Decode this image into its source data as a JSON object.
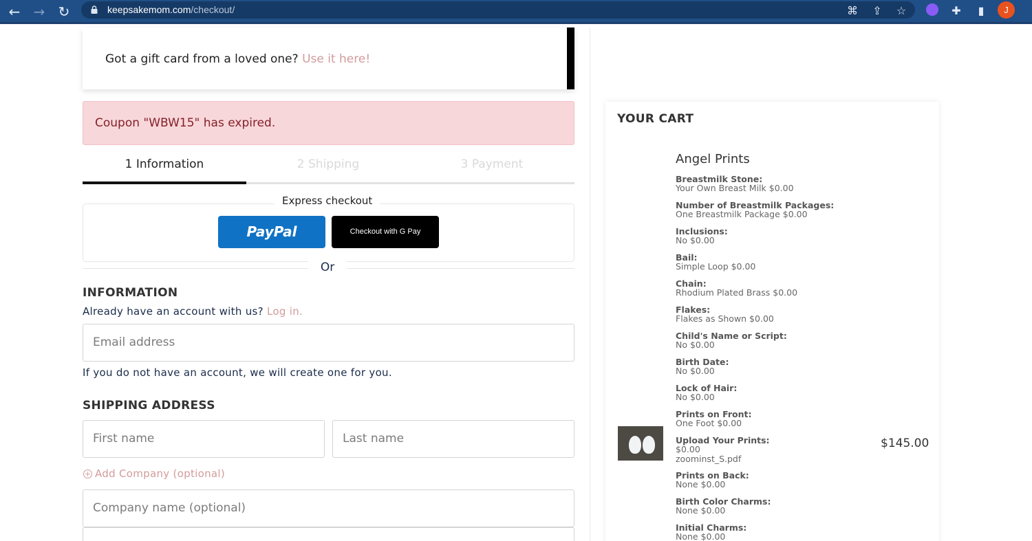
{
  "browser": {
    "url_host": "keepsakemom.com",
    "url_path": "/checkout/",
    "avatar_letter": "J"
  },
  "giftcard": {
    "prompt": "Got a gift card from a loved one?",
    "link": "Use it here!"
  },
  "alert": {
    "message": "Coupon \"WBW15\" has expired."
  },
  "steps": [
    {
      "label": "1 Information"
    },
    {
      "label": "2 Shipping"
    },
    {
      "label": "3 Payment"
    }
  ],
  "express": {
    "label": "Express checkout",
    "paypal_label": "PayPal",
    "gpay_label": "Checkout with G Pay",
    "or_label": "Or"
  },
  "information": {
    "heading": "INFORMATION",
    "account_prompt": "Already have an account with us?",
    "login_link": "Log in.",
    "email_placeholder": "Email address",
    "helper": "If you do not have an account, we will create one for you."
  },
  "shipping": {
    "heading": "SHIPPING ADDRESS",
    "first_name_placeholder": "First name",
    "last_name_placeholder": "Last name",
    "add_company": "Add Company (optional)",
    "company_placeholder": "Company name (optional)"
  },
  "cart": {
    "title": "YOUR CART",
    "product_name": "Angel Prints",
    "price": "$145.00",
    "options": [
      {
        "k": "Breastmilk Stone:",
        "v": "Your Own Breast Milk $0.00"
      },
      {
        "k": "Number of Breastmilk Packages:",
        "v": "One Breastmilk Package $0.00"
      },
      {
        "k": "Inclusions:",
        "v": "No $0.00"
      },
      {
        "k": "Bail:",
        "v": "Simple Loop $0.00"
      },
      {
        "k": "Chain:",
        "v": "Rhodium Plated Brass $0.00"
      },
      {
        "k": "Flakes:",
        "v": "Flakes as Shown $0.00"
      },
      {
        "k": "Child's Name or Script:",
        "v": "No $0.00"
      },
      {
        "k": "Birth Date:",
        "v": "No $0.00"
      },
      {
        "k": "Lock of Hair:",
        "v": "No $0.00"
      },
      {
        "k": "Prints on Front:",
        "v": "One Foot $0.00"
      },
      {
        "k": "Upload Your Prints:",
        "v": "$0.00",
        "v2": "zoominst_S.pdf"
      },
      {
        "k": "Prints on Back:",
        "v": "None $0.00"
      },
      {
        "k": "Birth Color Charms:",
        "v": "None $0.00"
      },
      {
        "k": "Initial Charms:",
        "v": "None $0.00"
      }
    ]
  }
}
